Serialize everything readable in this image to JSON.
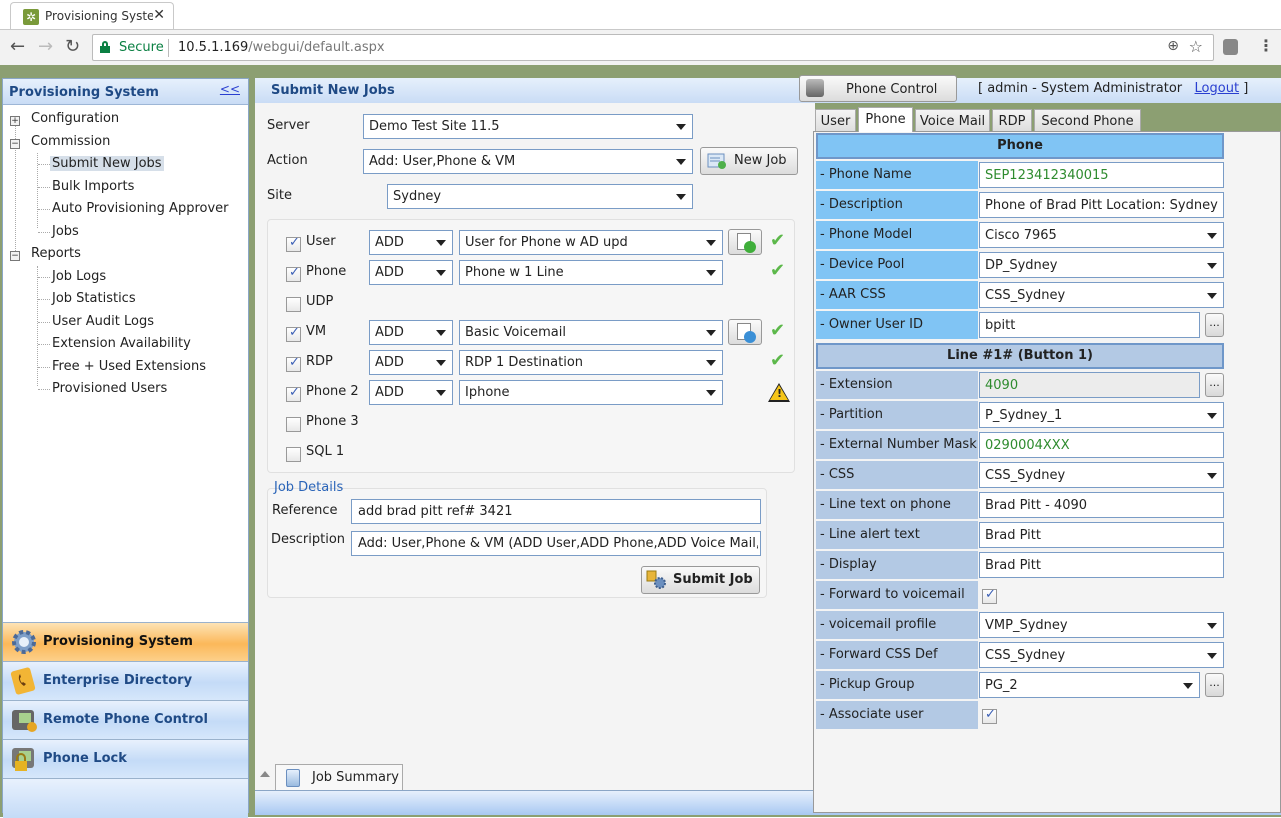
{
  "browser": {
    "tab_title": "Provisioning System + Pł",
    "secure_label": "Secure",
    "url_host": "10.5.1.169",
    "url_path": "/webgui/default.aspx"
  },
  "left_panel": {
    "title": "Provisioning System",
    "collapse_label": "<<",
    "tree": {
      "configuration": "Configuration",
      "commission": "Commission",
      "commission_items": [
        "Submit New Jobs",
        "Bulk Imports",
        "Auto Provisioning Approver",
        "Jobs"
      ],
      "reports": "Reports",
      "report_items": [
        "Job Logs",
        "Job Statistics",
        "User Audit Logs",
        "Extension Availability",
        "Free + Used Extensions",
        "Provisioned Users"
      ],
      "selected": "Submit New Jobs"
    },
    "accordion": [
      {
        "label": "Provisioning System",
        "icon": "gear-icon",
        "active": true
      },
      {
        "label": "Enterprise Directory",
        "icon": "phone-book-icon",
        "active": false
      },
      {
        "label": "Remote Phone Control",
        "icon": "phone-gear-icon",
        "active": false
      },
      {
        "label": "Phone Lock",
        "icon": "phone-lock-icon",
        "active": false
      }
    ]
  },
  "center": {
    "title": "Submit New Jobs",
    "server_label": "Server",
    "server_value": "Demo Test Site 11.5",
    "action_label": "Action",
    "action_value": "Add: User,Phone & VM",
    "new_job_label": "New Job",
    "site_label": "Site",
    "site_value": "Sydney",
    "tasks": [
      {
        "name": "User",
        "checked": true,
        "op": "ADD",
        "template": "User for Phone w AD upd",
        "button": "doc-check",
        "status": "ok"
      },
      {
        "name": "Phone",
        "checked": true,
        "op": "ADD",
        "template": "Phone w 1 Line",
        "button": null,
        "status": "ok"
      },
      {
        "name": "UDP",
        "checked": false,
        "op": null,
        "template": null,
        "button": null,
        "status": null
      },
      {
        "name": "VM",
        "checked": true,
        "op": "ADD",
        "template": "Basic Voicemail",
        "button": "doc-search",
        "status": "ok"
      },
      {
        "name": "RDP",
        "checked": true,
        "op": "ADD",
        "template": "RDP 1 Destination",
        "button": null,
        "status": "ok"
      },
      {
        "name": "Phone 2",
        "checked": true,
        "op": "ADD",
        "template": "Iphone",
        "button": null,
        "status": "warning"
      },
      {
        "name": "Phone 3",
        "checked": false,
        "op": null,
        "template": null,
        "button": null,
        "status": null
      },
      {
        "name": "SQL 1",
        "checked": false,
        "op": null,
        "template": null,
        "button": null,
        "status": null
      }
    ],
    "job_details": {
      "legend": "Job Details",
      "reference_label": "Reference",
      "reference_value": "add brad pitt ref# 3421",
      "description_label": "Description",
      "description_value": "Add: User,Phone & VM (ADD User,ADD Phone,ADD Voice Mail,ADD RDP",
      "submit_label": "Submit Job"
    },
    "job_summary_tab": "Job Summary"
  },
  "right": {
    "phone_control_label": "Phone Control",
    "user_info_prefix": "[ admin - System Administrator",
    "logout_label": "Logout",
    "user_info_suffix": "]",
    "tabs": [
      "User",
      "Phone",
      "Voice Mail",
      "RDP",
      "Second Phone"
    ],
    "active_tab": "Phone",
    "phone_section": "Phone",
    "phone_fields": [
      {
        "label": "- Phone Name",
        "value": "SEP123412340015",
        "type": "text",
        "green": true
      },
      {
        "label": "- Description",
        "value": "Phone of Brad Pitt Location: Sydney",
        "type": "text"
      },
      {
        "label": "- Phone Model",
        "value": "Cisco 7965",
        "type": "select"
      },
      {
        "label": "- Device Pool",
        "value": "DP_Sydney",
        "type": "select"
      },
      {
        "label": "- AAR CSS",
        "value": "CSS_Sydney",
        "type": "select"
      },
      {
        "label": "- Owner User ID",
        "value": "bpitt",
        "type": "text-lookup"
      }
    ],
    "line_section": "Line #1#  (Button 1)",
    "line_fields": [
      {
        "label": "- Extension",
        "value": "4090",
        "type": "readonly-lookup",
        "green": true
      },
      {
        "label": "- Partition",
        "value": "P_Sydney_1",
        "type": "select"
      },
      {
        "label": "- External Number Mask",
        "value": "0290004XXX",
        "type": "text",
        "green": true
      },
      {
        "label": "- CSS",
        "value": "CSS_Sydney",
        "type": "select"
      },
      {
        "label": "- Line text on phone",
        "value": "Brad Pitt - 4090",
        "type": "text"
      },
      {
        "label": "- Line alert text",
        "value": "Brad Pitt",
        "type": "text"
      },
      {
        "label": "- Display",
        "value": "Brad Pitt",
        "type": "text"
      },
      {
        "label": "- Forward to voicemail",
        "value": true,
        "type": "checkbox"
      },
      {
        "label": "- voicemail profile",
        "value": "VMP_Sydney",
        "type": "select"
      },
      {
        "label": "- Forward CSS Def",
        "value": "CSS_Sydney",
        "type": "select"
      },
      {
        "label": "- Pickup Group",
        "value": "PG_2",
        "type": "select-lookup"
      },
      {
        "label": "- Associate user",
        "value": true,
        "type": "checkbox"
      }
    ],
    "lookup_button_label": "..."
  }
}
